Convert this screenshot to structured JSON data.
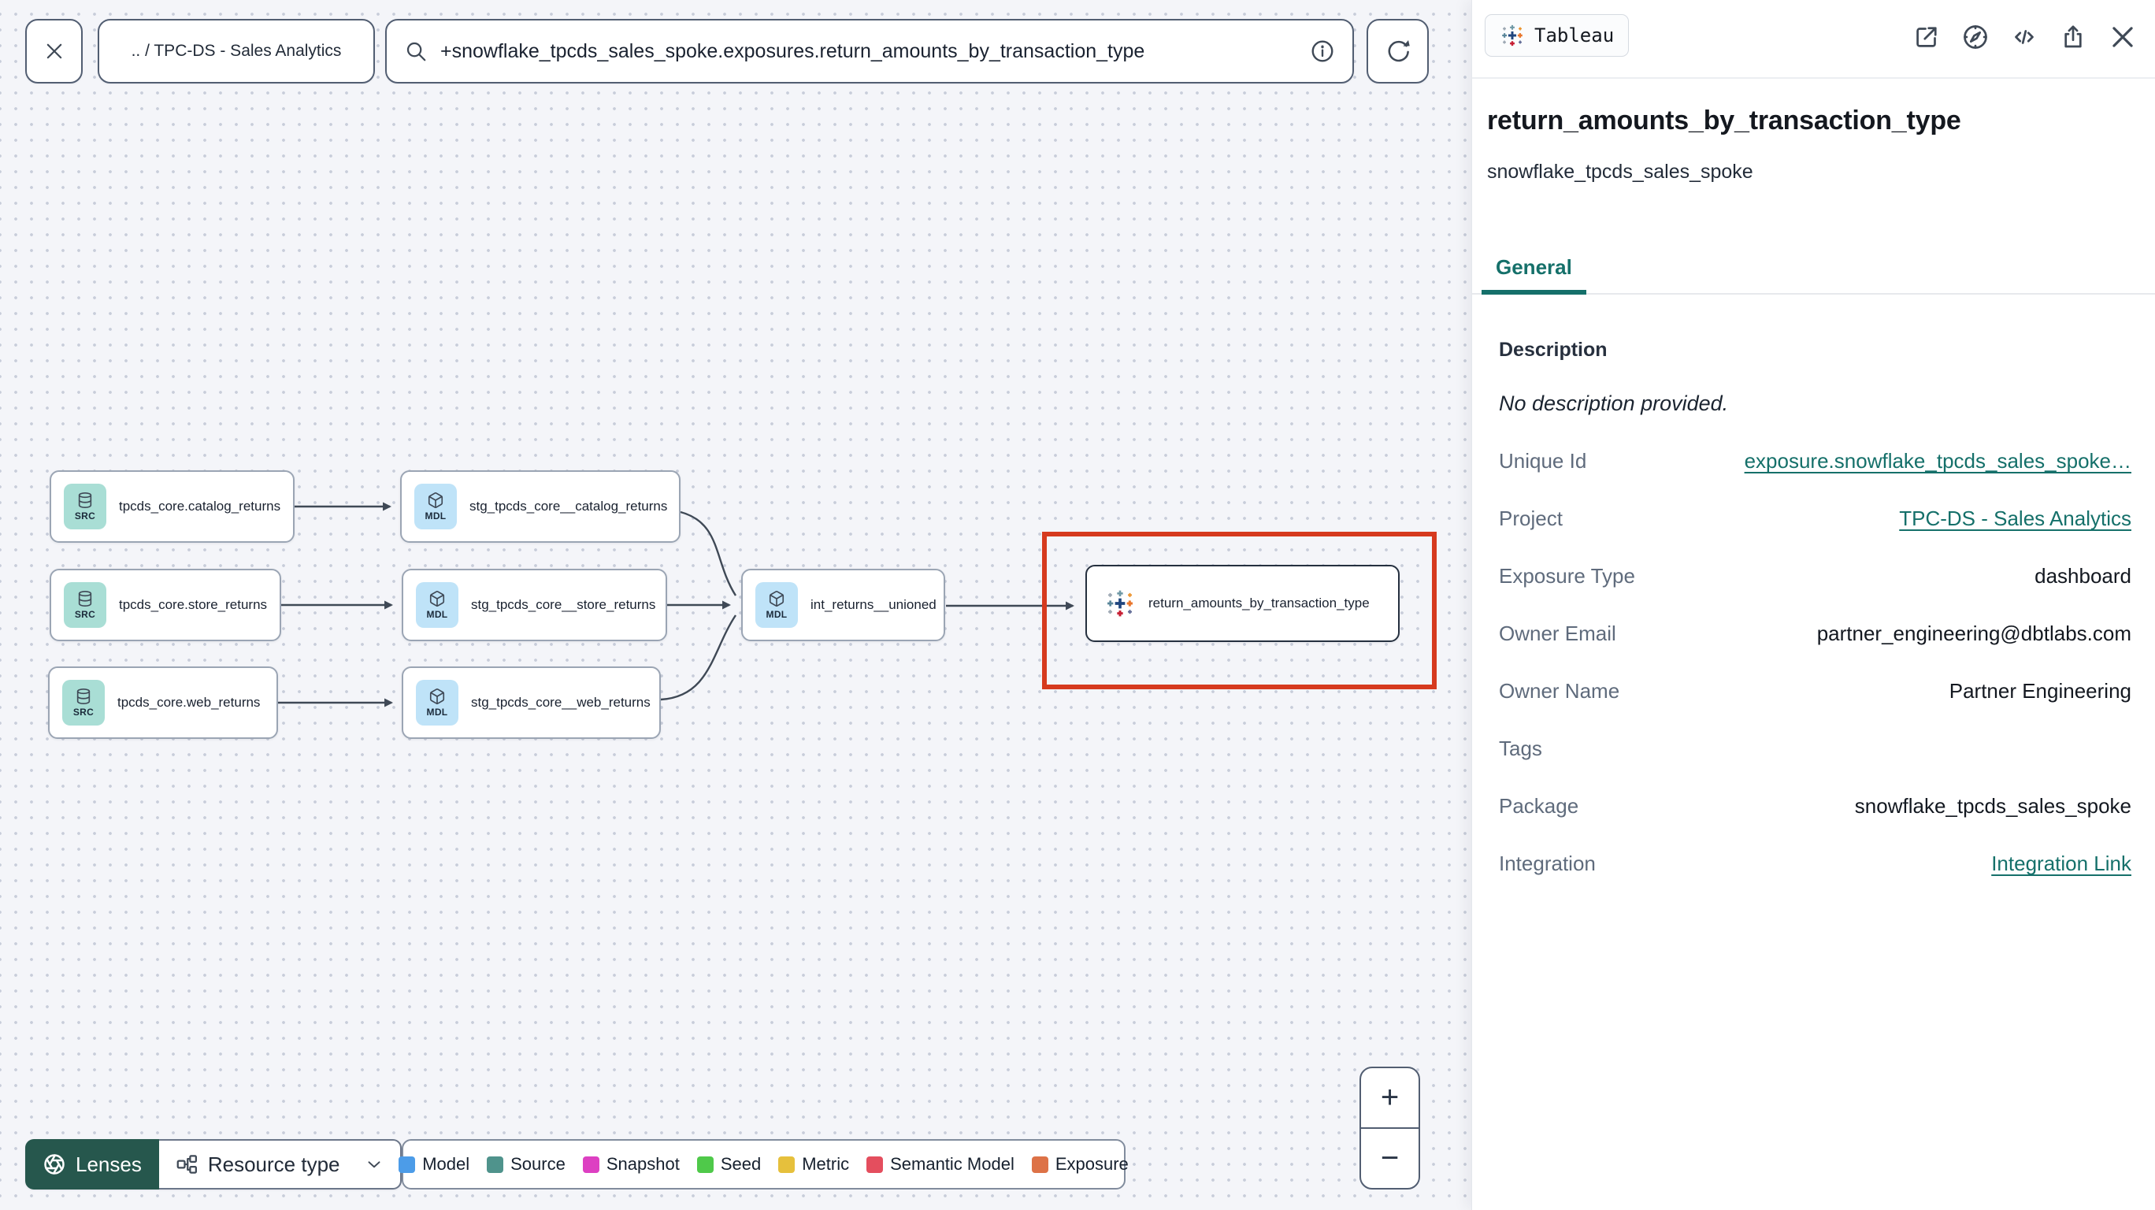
{
  "colors": {
    "accent_teal": "#15706A",
    "highlight_red": "#D63A1E",
    "lenses_green": "#26574D",
    "badge_src_bg": "#A9DED5",
    "badge_mdl_bg": "#BFE3F8"
  },
  "toolbar": {
    "breadcrumb": ".. / TPC-DS - Sales Analytics",
    "search_value": "+snowflake_tpcds_sales_spoke.exposures.return_amounts_by_transaction_type"
  },
  "graph": {
    "nodes": [
      {
        "badge": "SRC",
        "label": "tpcds_core.catalog_returns"
      },
      {
        "badge": "MDL",
        "label": "stg_tpcds_core__catalog_returns"
      },
      {
        "badge": "SRC",
        "label": "tpcds_core.store_returns"
      },
      {
        "badge": "MDL",
        "label": "stg_tpcds_core__store_returns"
      },
      {
        "badge": "MDL",
        "label": "int_returns__unioned"
      },
      {
        "badge": "SRC",
        "label": "tpcds_core.web_returns"
      },
      {
        "badge": "MDL",
        "label": "stg_tpcds_core__web_returns"
      },
      {
        "badge": "",
        "label": "return_amounts_by_transaction_type"
      }
    ],
    "legend": [
      {
        "label": "Model",
        "color": "#4C9CE8"
      },
      {
        "label": "Source",
        "color": "#4F938C"
      },
      {
        "label": "Snapshot",
        "color": "#DD40C2"
      },
      {
        "label": "Seed",
        "color": "#4FC94A"
      },
      {
        "label": "Metric",
        "color": "#E6C03C"
      },
      {
        "label": "Semantic Model",
        "color": "#E44E5E"
      },
      {
        "label": "Exposure",
        "color": "#DD7247"
      }
    ],
    "lenses_label": "Lenses",
    "resource_type_label": "Resource type"
  },
  "zoom_controls": {
    "zoom_in": "+",
    "zoom_out": "−"
  },
  "sidebar": {
    "badge_label": "Tableau",
    "title": "return_amounts_by_transaction_type",
    "subtitle": "snowflake_tpcds_sales_spoke",
    "tab": "General",
    "description_heading": "Description",
    "description_empty": "No description provided.",
    "fields": [
      {
        "label": "Unique Id",
        "value": "exposure.snowflake_tpcds_sales_spoke…"
      },
      {
        "label": "Project",
        "value": "TPC-DS - Sales Analytics"
      },
      {
        "label": "Exposure Type",
        "value": "dashboard"
      },
      {
        "label": "Owner Email",
        "value": "partner_engineering@dbtlabs.com"
      },
      {
        "label": "Owner Name",
        "value": "Partner Engineering"
      },
      {
        "label": "Tags",
        "value": ""
      },
      {
        "label": "Package",
        "value": "snowflake_tpcds_sales_spoke"
      },
      {
        "label": "Integration",
        "value": "Integration Link"
      }
    ]
  }
}
